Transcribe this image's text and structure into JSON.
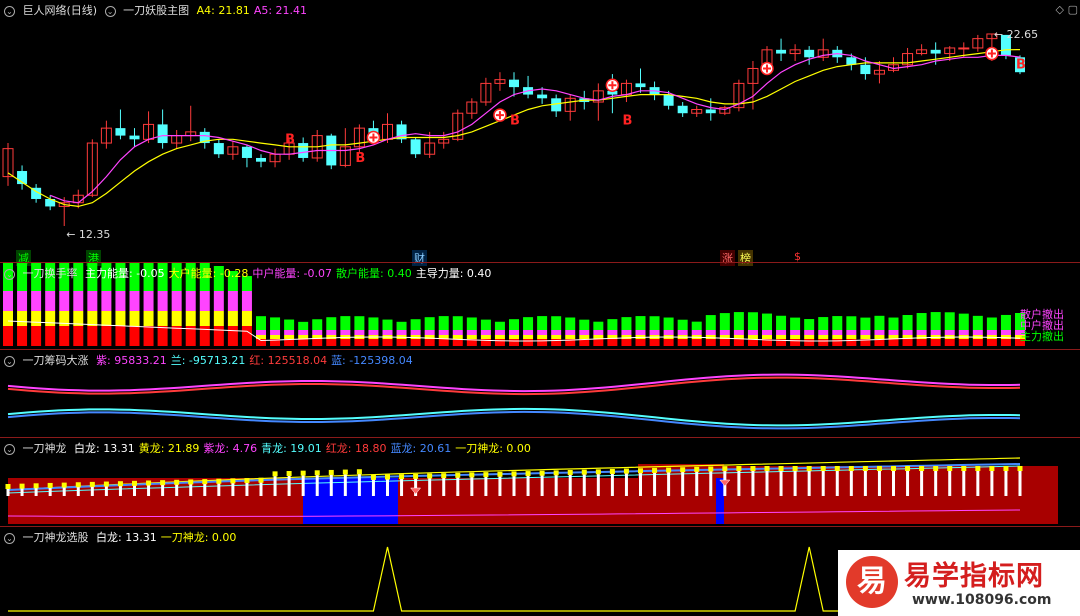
{
  "colors": {
    "up": "#ff3b3b",
    "down": "#54ffff",
    "ma4": "#ffff00",
    "ma5": "#ff44ff",
    "bg": "#000000"
  },
  "panel1": {
    "title": "巨人网络(日线)",
    "indicator": "一刀妖股主图",
    "params": [
      {
        "label": "A4: ",
        "value": "21.81",
        "color": "#ffff00"
      },
      {
        "label": "A5: ",
        "value": "21.41",
        "color": "#ff44ff"
      }
    ],
    "high_label": "22.65",
    "low_label": "12.35",
    "tags": [
      {
        "text": "减",
        "color": "#00ff00",
        "bg": "#004400"
      },
      {
        "text": "港",
        "color": "#00ff00",
        "bg": "#004400"
      },
      {
        "text": "财",
        "color": "#88ccff",
        "bg": "#002244"
      },
      {
        "text": "涨",
        "color": "#ff6666",
        "bg": "#440000"
      },
      {
        "text": "榜",
        "color": "#ffff55",
        "bg": "#443300"
      },
      {
        "text": "$",
        "color": "#ff3333",
        "bg": ""
      }
    ],
    "b_label": "B"
  },
  "panel2": {
    "indicator": "一刀换手率",
    "params": [
      {
        "label": "主力能量: ",
        "value": "-0.05",
        "color": "#ffffff"
      },
      {
        "label": "大户能量: ",
        "value": "-0.28",
        "color": "#ffff00"
      },
      {
        "label": "中户能量: ",
        "value": "-0.07",
        "color": "#ff44ff"
      },
      {
        "label": "散户能量: ",
        "value": "0.40",
        "color": "#00ff00"
      },
      {
        "label": "主导力量: ",
        "value": "0.40",
        "color": "#ffffff"
      }
    ],
    "legend": [
      {
        "text": "散户撤出",
        "color": "#ff44ff"
      },
      {
        "text": "中户撤出",
        "color": "#ff44ff"
      },
      {
        "text": "主力撤出",
        "color": "#00ff00"
      }
    ]
  },
  "panel3": {
    "indicator": "一刀筹码大涨",
    "params": [
      {
        "label": "紫: ",
        "value": "95833.21",
        "color": "#ff44ff"
      },
      {
        "label": "兰: ",
        "value": "-95713.21",
        "color": "#54ffff"
      },
      {
        "label": "红: ",
        "value": "125518.04",
        "color": "#ff3b3b"
      },
      {
        "label": "蓝: ",
        "value": "-125398.04",
        "color": "#4488ff"
      }
    ]
  },
  "panel4": {
    "indicator": "一刀神龙",
    "params": [
      {
        "label": "白龙: ",
        "value": "13.31",
        "color": "#ffffff"
      },
      {
        "label": "黄龙: ",
        "value": "21.89",
        "color": "#ffff00"
      },
      {
        "label": "紫龙: ",
        "value": "4.76",
        "color": "#ff44ff"
      },
      {
        "label": "青龙: ",
        "value": "19.01",
        "color": "#54ffff"
      },
      {
        "label": "红龙: ",
        "value": "18.80",
        "color": "#ff3b3b"
      },
      {
        "label": "蓝龙: ",
        "value": "20.61",
        "color": "#4488ff"
      },
      {
        "label": "一刀神龙: ",
        "value": "0.00",
        "color": "#ffff00"
      }
    ]
  },
  "panel5": {
    "indicator": "一刀神龙选股",
    "params": [
      {
        "label": "白龙: ",
        "value": "13.31",
        "color": "#ffffff"
      },
      {
        "label": "一刀神龙: ",
        "value": "0.00",
        "color": "#ffff00"
      }
    ]
  },
  "watermark": {
    "site": "易学指标网",
    "url": "www.108096.com",
    "glyph": "易"
  },
  "chart_data": [
    {
      "type": "candlestick",
      "candles": [
        [
          15,
          16.5,
          14.5,
          16.8
        ],
        [
          15.3,
          14.6,
          14.3,
          15.6
        ],
        [
          14.4,
          13.8,
          13.6,
          14.6
        ],
        [
          13.8,
          13.4,
          13.2,
          14.0
        ],
        [
          13.4,
          13.6,
          12.35,
          13.9
        ],
        [
          13.6,
          14.0,
          13.3,
          14.3
        ],
        [
          14.0,
          16.8,
          13.9,
          17.0
        ],
        [
          16.8,
          17.6,
          16.5,
          18.0
        ],
        [
          17.6,
          17.2,
          17.0,
          18.6
        ],
        [
          17.2,
          17.0,
          16.6,
          17.6
        ],
        [
          17.0,
          17.8,
          16.8,
          18.5
        ],
        [
          17.8,
          16.8,
          16.5,
          18.6
        ],
        [
          16.8,
          17.2,
          16.5,
          17.5
        ],
        [
          17.2,
          17.4,
          16.9,
          18.8
        ],
        [
          17.4,
          16.8,
          16.5,
          17.6
        ],
        [
          16.8,
          16.2,
          16.0,
          17.0
        ],
        [
          16.2,
          16.6,
          15.9,
          16.9
        ],
        [
          16.6,
          16.0,
          15.5,
          16.7
        ],
        [
          16.0,
          15.8,
          15.5,
          16.2
        ],
        [
          15.8,
          16.2,
          15.5,
          16.5
        ],
        [
          16.2,
          16.8,
          15.9,
          17.0
        ],
        [
          16.8,
          16.0,
          15.8,
          17.1
        ],
        [
          16.0,
          17.2,
          15.8,
          17.5
        ],
        [
          17.2,
          15.6,
          15.4,
          17.3
        ],
        [
          15.6,
          16.6,
          15.5,
          17.6
        ],
        [
          16.6,
          17.6,
          16.3,
          17.8
        ],
        [
          17.6,
          17.0,
          16.8,
          18.0
        ],
        [
          17.0,
          17.8,
          16.8,
          18.4
        ],
        [
          17.8,
          17.0,
          16.8,
          18.0
        ],
        [
          17.0,
          16.2,
          16.0,
          17.1
        ],
        [
          16.2,
          16.8,
          16.0,
          17.4
        ],
        [
          16.8,
          17.0,
          16.5,
          17.4
        ],
        [
          17.0,
          18.4,
          16.9,
          18.6
        ],
        [
          18.4,
          19.0,
          18.1,
          19.2
        ],
        [
          19.0,
          20.0,
          18.8,
          20.3
        ],
        [
          20.0,
          20.2,
          19.6,
          20.6
        ],
        [
          20.2,
          19.8,
          19.3,
          20.6
        ],
        [
          19.8,
          19.4,
          19.2,
          20.4
        ],
        [
          19.4,
          19.2,
          18.9,
          19.8
        ],
        [
          19.2,
          18.5,
          18.2,
          19.4
        ],
        [
          18.5,
          19.2,
          18.0,
          19.4
        ],
        [
          19.2,
          19.0,
          18.6,
          19.6
        ],
        [
          19.0,
          19.6,
          18.0,
          20.0
        ],
        [
          19.6,
          19.4,
          18.4,
          20.5
        ],
        [
          19.4,
          20.0,
          19.0,
          20.2
        ],
        [
          20.0,
          19.8,
          19.5,
          20.8
        ],
        [
          19.8,
          19.4,
          19.1,
          20.1
        ],
        [
          19.4,
          18.8,
          18.6,
          19.6
        ],
        [
          18.8,
          18.4,
          18.2,
          19.0
        ],
        [
          18.4,
          18.6,
          18.2,
          18.8
        ],
        [
          18.6,
          18.4,
          18.0,
          19.2
        ],
        [
          18.4,
          18.7,
          18.3,
          18.8
        ],
        [
          18.7,
          20.0,
          18.5,
          20.2
        ],
        [
          20.0,
          20.8,
          18.6,
          21.2
        ],
        [
          20.8,
          21.8,
          20.6,
          22.0
        ],
        [
          21.8,
          21.6,
          21.2,
          22.4
        ],
        [
          21.6,
          21.8,
          21.2,
          22.1
        ],
        [
          21.8,
          21.4,
          21.0,
          22.0
        ],
        [
          21.4,
          21.8,
          21.2,
          22.4
        ],
        [
          21.8,
          21.4,
          21.1,
          22.0
        ],
        [
          21.4,
          21.0,
          20.7,
          21.6
        ],
        [
          21.0,
          20.5,
          20.2,
          21.4
        ],
        [
          20.5,
          20.7,
          20.0,
          21.2
        ],
        [
          20.7,
          21.0,
          20.6,
          21.4
        ],
        [
          21.0,
          21.6,
          20.8,
          21.9
        ],
        [
          21.6,
          21.8,
          21.5,
          22.1
        ],
        [
          21.8,
          21.6,
          21.0,
          22.2
        ],
        [
          21.6,
          21.9,
          21.2,
          22.0
        ],
        [
          21.9,
          21.9,
          21.4,
          22.2
        ],
        [
          21.9,
          22.4,
          21.7,
          22.6
        ],
        [
          22.4,
          22.65,
          21.2,
          22.65
        ],
        [
          22.6,
          21.5,
          21.3,
          22.6
        ],
        [
          21.4,
          20.6,
          20.5,
          21.5
        ]
      ],
      "ma4": [
        15.2,
        14.7,
        14.2,
        13.8,
        13.5,
        13.4,
        13.6,
        14.1,
        14.7,
        15.3,
        15.8,
        16.2,
        16.5,
        16.7,
        16.9,
        17.0,
        17.0,
        16.9,
        16.8,
        16.7,
        16.6,
        16.6,
        16.6,
        16.7,
        16.7,
        16.8,
        16.9,
        17.0,
        17.1,
        17.1,
        17.1,
        17.1,
        17.2,
        17.4,
        17.7,
        18.0,
        18.3,
        18.6,
        18.8,
        18.9,
        19.0,
        19.1,
        19.1,
        19.2,
        19.3,
        19.4,
        19.4,
        19.4,
        19.3,
        19.2,
        19.0,
        18.9,
        18.9,
        19.0,
        19.3,
        19.7,
        20.1,
        20.4,
        20.7,
        20.9,
        21.0,
        21.1,
        21.1,
        21.1,
        21.1,
        21.2,
        21.3,
        21.4,
        21.5,
        21.6,
        21.7,
        21.8,
        21.81
      ],
      "ma5": [
        null,
        null,
        null,
        14.0,
        13.7,
        13.6,
        14.2,
        15.0,
        15.9,
        16.6,
        17.0,
        17.2,
        17.2,
        17.2,
        17.2,
        17.1,
        16.9,
        16.7,
        16.4,
        16.2,
        16.2,
        16.3,
        16.4,
        16.4,
        16.4,
        16.5,
        16.7,
        17.0,
        17.2,
        17.3,
        17.2,
        17.2,
        17.4,
        17.8,
        18.4,
        19.0,
        19.4,
        19.6,
        19.7,
        19.6,
        19.4,
        19.2,
        19.1,
        19.3,
        19.4,
        19.6,
        19.6,
        19.5,
        19.2,
        18.9,
        18.7,
        18.6,
        18.9,
        19.3,
        20.0,
        20.6,
        21.0,
        21.3,
        21.5,
        21.6,
        21.5,
        21.2,
        21.0,
        20.8,
        20.9,
        21.0,
        21.2,
        21.3,
        21.4,
        21.4,
        21.5,
        21.5,
        21.41
      ]
    },
    {
      "type": "bar",
      "series": [
        "散户能量",
        "中户能量",
        "大户能量",
        "主力能量"
      ],
      "values": [
        [
          0.45,
          0.2,
          0.15,
          0.18
        ],
        [
          0.5,
          0.2,
          0.15,
          0.18
        ],
        [
          0.5,
          0.25,
          0.2,
          0.2
        ],
        [
          0.4,
          0.2,
          0.2,
          0.2
        ],
        [
          0.3,
          0.15,
          0.15,
          0.15
        ],
        [
          0.3,
          0.15,
          0.15,
          0.2
        ],
        [
          0.4,
          0.2,
          0.2,
          0.2
        ],
        [
          0.6,
          0.2,
          0.2,
          0.22
        ],
        [
          0.6,
          0.25,
          0.2,
          0.22
        ],
        [
          0.55,
          0.2,
          0.15,
          0.2
        ],
        [
          0.45,
          0.2,
          0.15,
          0.18
        ],
        [
          0.4,
          0.18,
          0.15,
          0.15
        ],
        [
          0.35,
          0.15,
          0.12,
          0.15
        ],
        [
          0.35,
          0.12,
          0.1,
          0.15
        ],
        [
          0.3,
          0.1,
          0.1,
          0.1
        ],
        [
          0.25,
          0.1,
          0.1,
          0.1
        ],
        [
          0.2,
          0.08,
          0.08,
          0.08
        ],
        [
          0.15,
          0.05,
          0.05,
          0.06
        ]
      ]
    },
    {
      "type": "line",
      "series": [
        {
          "name": "紫",
          "color": "#ff44ff"
        },
        {
          "name": "兰",
          "color": "#54ffff"
        },
        {
          "name": "红",
          "color": "#ff3b3b"
        },
        {
          "name": "蓝",
          "color": "#4488ff"
        }
      ]
    },
    {
      "type": "area",
      "series": [
        {
          "name": "红龙"
        },
        {
          "name": "蓝龙"
        },
        {
          "name": "黄龙"
        },
        {
          "name": "紫龙"
        }
      ]
    },
    {
      "type": "line",
      "series": [
        {
          "name": "一刀神龙",
          "values_peaks_at": [
            27,
            57
          ]
        }
      ]
    }
  ]
}
